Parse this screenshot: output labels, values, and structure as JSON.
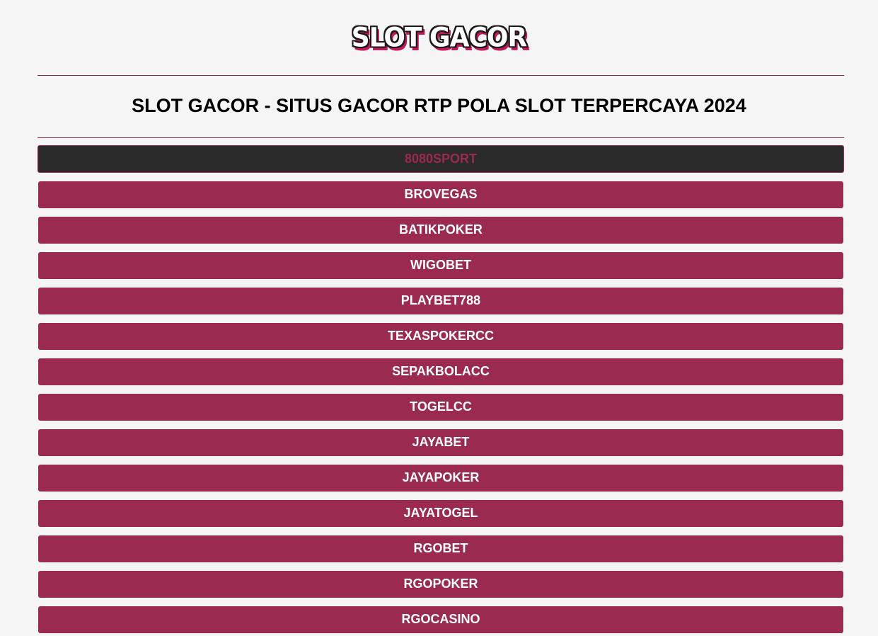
{
  "logo": {
    "text": "SLOT GACOR"
  },
  "page_title": "SLOT GACOR - SITUS GACOR RTP POLA SLOT TERPERCAYA 2024",
  "links": [
    {
      "label": "8080SPORT",
      "active": true
    },
    {
      "label": "BROVEGAS"
    },
    {
      "label": "BATIKPOKER"
    },
    {
      "label": "WIGOBET"
    },
    {
      "label": "PLAYBET788"
    },
    {
      "label": "TEXASPOKERCC"
    },
    {
      "label": "SEPAKBOLACC"
    },
    {
      "label": "TOGELCC"
    },
    {
      "label": "JAYABET"
    },
    {
      "label": "JAYAPOKER"
    },
    {
      "label": "JAYATOGEL"
    },
    {
      "label": "RGOBET"
    },
    {
      "label": "RGOPOKER"
    },
    {
      "label": "RGOCASINO"
    }
  ],
  "colors": {
    "accent": "#9b2a50",
    "active_bg": "#2a2a2a",
    "page_bg": "#f5f5f5",
    "button_text": "#ffffff"
  }
}
